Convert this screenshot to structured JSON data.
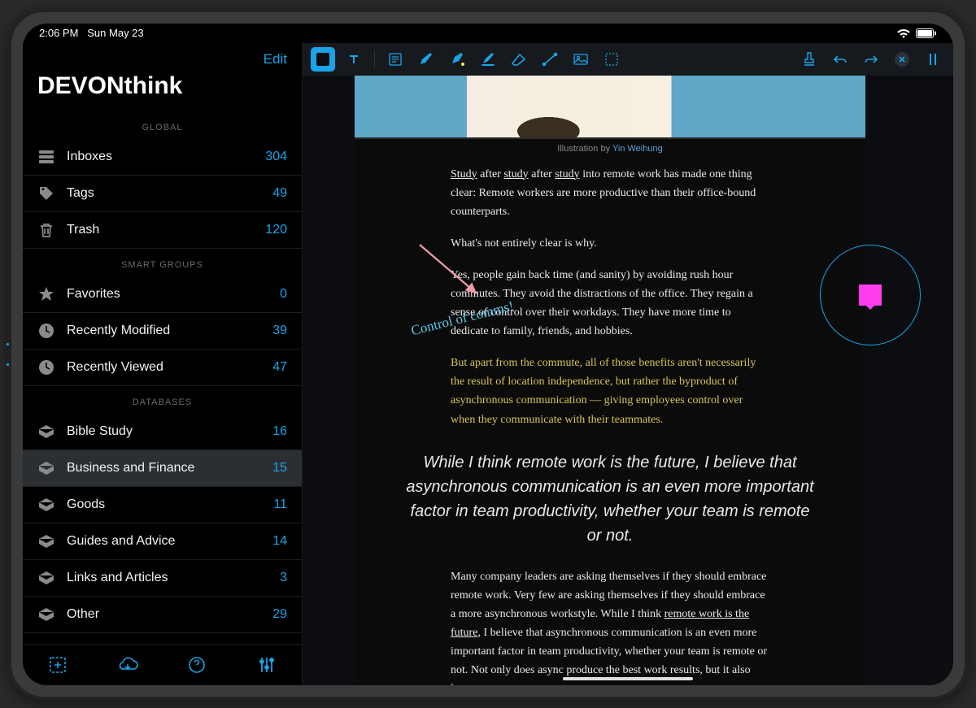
{
  "status": {
    "time": "2:06 PM",
    "date": "Sun May 23"
  },
  "sidebar": {
    "edit": "Edit",
    "title": "DEVONthink",
    "sections": {
      "global": "GLOBAL",
      "smart": "SMART GROUPS",
      "databases": "DATABASES"
    },
    "global": [
      {
        "label": "Inboxes",
        "count": "304"
      },
      {
        "label": "Tags",
        "count": "49"
      },
      {
        "label": "Trash",
        "count": "120"
      }
    ],
    "smart": [
      {
        "label": "Favorites",
        "count": "0"
      },
      {
        "label": "Recently Modified",
        "count": "39"
      },
      {
        "label": "Recently Viewed",
        "count": "47"
      }
    ],
    "databases": [
      {
        "label": "Bible Study",
        "count": "16"
      },
      {
        "label": "Business and Finance",
        "count": "15"
      },
      {
        "label": "Goods",
        "count": "11"
      },
      {
        "label": "Guides and Advice",
        "count": "14"
      },
      {
        "label": "Links and Articles",
        "count": "3"
      },
      {
        "label": "Other",
        "count": "29"
      }
    ]
  },
  "document": {
    "credit_prefix": "Illustration by ",
    "credit_link": "Yin Weihung",
    "p1_a": "Study",
    "p1_b": " after ",
    "p1_c": "study",
    "p1_d": " after ",
    "p1_e": "study",
    "p1_f": " into remote work has made one thing clear: Remote workers are more productive than their office-bound counterparts.",
    "p2": "What's not entirely clear is why.",
    "p3": "Yes, people gain back time (and sanity) by avoiding rush hour commutes. They avoid the distractions of the office. They regain a sense of control over their workdays. They have more time to dedicate to family, friends, and hobbies.",
    "p4": "But apart from the commute, all of those benefits aren't necessarily the result of location independence, but rather the byproduct of asynchronous communication — giving employees control over when they communicate with their teammates.",
    "pullquote": "While I think remote work is the future, I believe that asynchronous communication is an even more important factor in team productivity, whether your team is remote or not.",
    "p5_a": "Many company leaders are asking themselves if they should embrace remote work. Very few are asking themselves if they should embrace a more asynchronous workstyle. While I think ",
    "p5_link": "remote work is the future",
    "p5_b": ", I believe that asynchronous communication is an even more important factor in team productivity, whether your team is remote or not. Not only does async produce the best work results, but it also lets",
    "annotation": "Control of comms!"
  }
}
